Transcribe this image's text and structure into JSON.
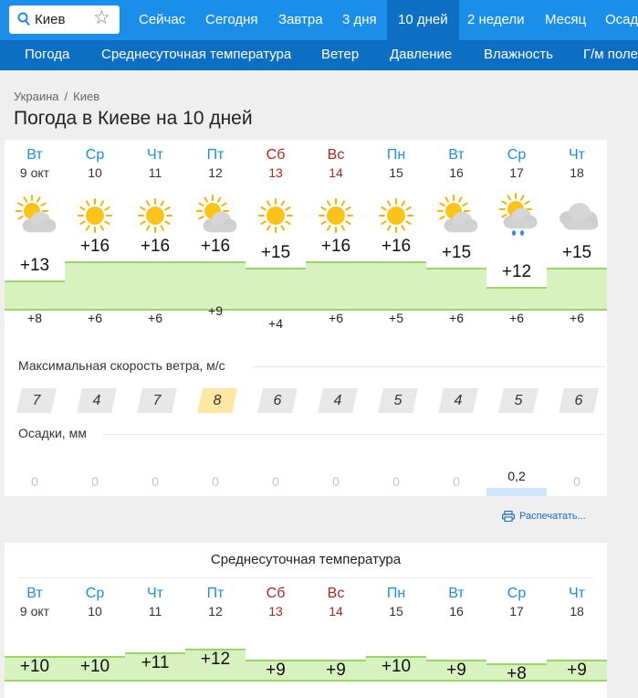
{
  "nav": {
    "search_value": "Киев",
    "tabs": [
      "Сейчас",
      "Сегодня",
      "Завтра",
      "3 дня",
      "10 дней",
      "2 недели",
      "Месяц",
      "Осад"
    ],
    "active_tab": "10 дней",
    "subnav": [
      "Погода",
      "Среднесуточная температура",
      "Ветер",
      "Давление",
      "Влажность",
      "Г/м поле"
    ]
  },
  "breadcrumb": [
    "Украина",
    "Киев"
  ],
  "page_title": "Погода в Киеве на 10 дней",
  "days": [
    {
      "name": "Вт",
      "date": "9 окт",
      "weekend": false,
      "icon": "partly-cloudy-icon",
      "tmax": "+13",
      "tmin": "+8",
      "wind": "7",
      "precip": "0",
      "tavg": "+10"
    },
    {
      "name": "Ср",
      "date": "10",
      "weekend": false,
      "icon": "sun-icon",
      "tmax": "+16",
      "tmin": "+6",
      "wind": "4",
      "precip": "0",
      "tavg": "+10"
    },
    {
      "name": "Чт",
      "date": "11",
      "weekend": false,
      "icon": "sun-icon",
      "tmax": "+16",
      "tmin": "+6",
      "wind": "7",
      "precip": "0",
      "tavg": "+11"
    },
    {
      "name": "Пт",
      "date": "12",
      "weekend": false,
      "icon": "partly-cloudy-icon",
      "tmax": "+16",
      "tmin": "+9",
      "wind": "8",
      "precip": "0",
      "tavg": "+12"
    },
    {
      "name": "Сб",
      "date": "13",
      "weekend": true,
      "icon": "sun-icon",
      "tmax": "+15",
      "tmin": "+4",
      "wind": "6",
      "precip": "0",
      "tavg": "+9"
    },
    {
      "name": "Вс",
      "date": "14",
      "weekend": true,
      "icon": "sun-icon",
      "tmax": "+16",
      "tmin": "+6",
      "wind": "4",
      "precip": "0",
      "tavg": "+9"
    },
    {
      "name": "Пн",
      "date": "15",
      "weekend": false,
      "icon": "sun-icon",
      "tmax": "+16",
      "tmin": "+5",
      "wind": "5",
      "precip": "0",
      "tavg": "+10"
    },
    {
      "name": "Вт",
      "date": "16",
      "weekend": false,
      "icon": "partly-cloudy-icon",
      "tmax": "+15",
      "tmin": "+6",
      "wind": "4",
      "precip": "0",
      "tavg": "+9"
    },
    {
      "name": "Ср",
      "date": "17",
      "weekend": false,
      "icon": "rain-icon",
      "tmax": "+12",
      "tmin": "+6",
      "wind": "5",
      "precip": "0,2",
      "tavg": "+8"
    },
    {
      "name": "Чт",
      "date": "18",
      "weekend": false,
      "icon": "cloud-icon",
      "tmax": "+15",
      "tmin": "+6",
      "wind": "6",
      "precip": "0",
      "tavg": "+9"
    }
  ],
  "labels": {
    "wind": "Максимальная скорость ветра, м/с",
    "precip": "Осадки, мм",
    "print": "Распечатать...",
    "avg_title": "Среднесуточная температура"
  },
  "colors": {
    "accent": "#1a8ee8",
    "nav_dark": "#0d6fc4",
    "weekend": "#b3261e",
    "temp_band": "#d7f1bf"
  }
}
